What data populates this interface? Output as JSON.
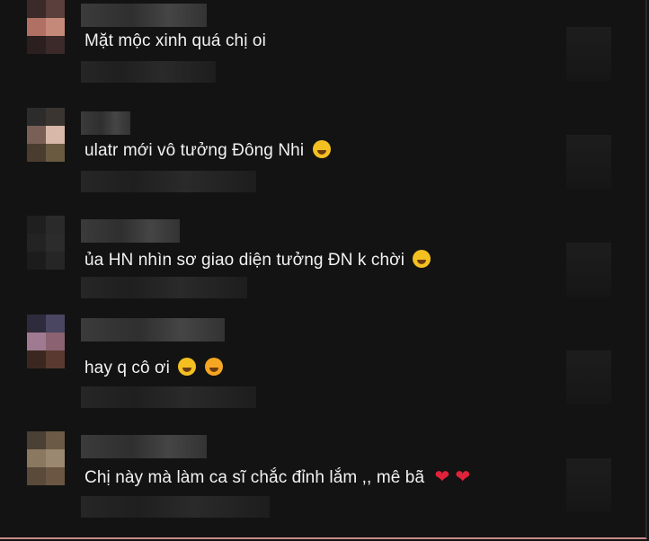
{
  "comments": [
    {
      "text": "Mặt mộc xinh quá chị oi",
      "emojis": []
    },
    {
      "text": "ulatr mới vô tưởng Đông Nhi",
      "emojis": [
        "laughing-face"
      ]
    },
    {
      "text": "ủa HN nhìn sơ giao diện tưởng ĐN k chời",
      "emojis": [
        "rolling-laughing-face"
      ]
    },
    {
      "text": "hay q cô ơi",
      "emojis": [
        "smiling-face",
        "heart-eyes-face"
      ]
    },
    {
      "text": "Chị này mà làm ca sĩ chắc đỉnh lắm ,, mê bã",
      "emojis": [
        "red-heart",
        "red-heart"
      ]
    }
  ],
  "colors": {
    "background": "#131313",
    "text": "#f2f2f2",
    "emoji": "#f4c021",
    "heart": "#e0223a"
  }
}
